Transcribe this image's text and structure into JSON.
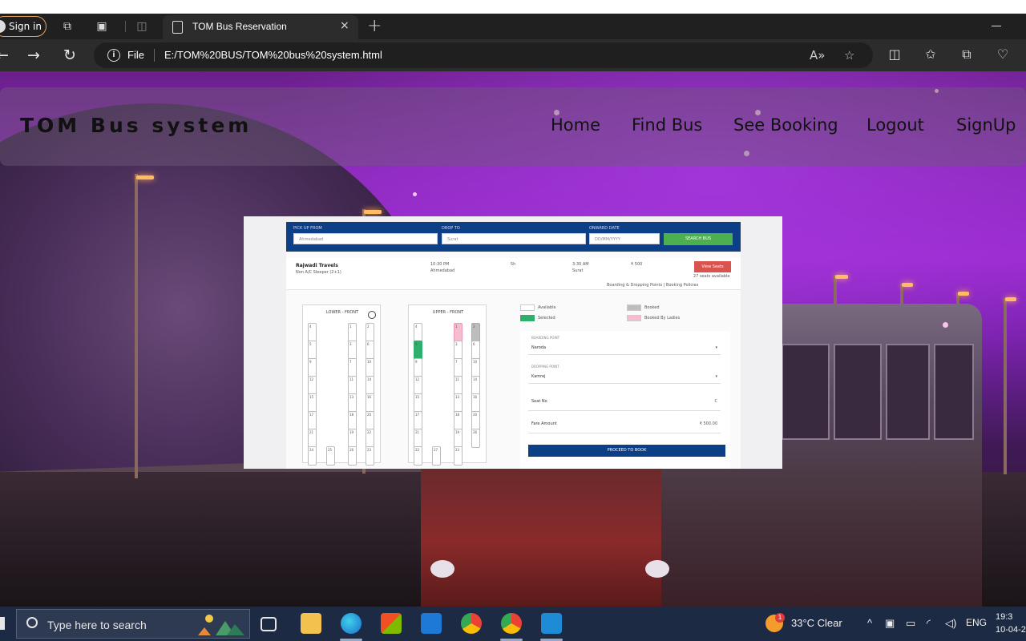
{
  "browser": {
    "sign_in_label": "Sign in",
    "tab_title": "TOM Bus Reservation",
    "new_tab_symbol": "+",
    "close_tab_symbol": "×",
    "file_label": "File",
    "url": "E:/TOM%20BUS/TOM%20bus%20system.html"
  },
  "site": {
    "brand": "TOM Bus system",
    "nav": [
      "Home",
      "Find Bus",
      "See Booking",
      "Logout",
      "SignUp"
    ]
  },
  "embedded_screenshot": {
    "search": {
      "pickup_label": "PICK UP FROM",
      "pickup_value": "Ahmedabad",
      "drop_label": "DROP TO",
      "drop_value": "Surat",
      "date_label": "ONWARD DATE",
      "date_value": "DD/MM/YYYY",
      "search_button": "SEARCH BUS"
    },
    "bus": {
      "name": "Rajwadi Travels",
      "type": "Non A/C Sleeper (2+1)",
      "depart_time": "10:30 PM",
      "depart_city": "Ahmedabad",
      "duration": "5h",
      "arrive_time": "3:30 AM",
      "arrive_city": "Surat",
      "price": "₹ 500",
      "view_button": "View Seats",
      "seats_available": "27 seats available",
      "links": "Boarding & Dropping Points  |  Booking Policies"
    },
    "lower_deck_title": "LOWER - FRONT",
    "upper_deck_title": "UPPER - FRONT",
    "lower_seats": [
      "4",
      "1",
      "2",
      "5",
      "3",
      "6",
      "9",
      "7",
      "10",
      "12",
      "11",
      "14",
      "15",
      "13",
      "16",
      "17",
      "18",
      "20",
      "21",
      "19",
      "22",
      "24",
      "25",
      "26",
      "23"
    ],
    "upper_seats": [
      "4",
      "1",
      "2",
      "5",
      "3",
      "6",
      "9",
      "7",
      "10",
      "12",
      "11",
      "14",
      "15",
      "13",
      "16",
      "17",
      "18",
      "20",
      "21",
      "19",
      "26",
      "22",
      "27",
      "23"
    ],
    "legend": {
      "available": "Available",
      "selected": "Selected",
      "booked": "Booked",
      "booked_ladies": "Booked By Ladies"
    },
    "form": {
      "boarding_label": "BOARDING POINT",
      "boarding_value": "Naroda",
      "dropping_label": "DROPPING POINT",
      "dropping_value": "Kamrej",
      "seat_label": "Seat No",
      "seat_value": "C",
      "fare_label": "Fare Amount",
      "fare_value": "₹ 500.00",
      "proceed_button": "PROCEED TO BOOK"
    }
  },
  "taskbar": {
    "search_placeholder": "Type here to search",
    "weather": "33°C  Clear",
    "weather_badge": "1",
    "language": "ENG",
    "time": "19:3",
    "date": "10-04-2"
  },
  "colors": {
    "tab_bar": "#202020",
    "address_bar": "#2c2c2c",
    "taskbar": "#1c2a44",
    "app_blue": "#0d3f86",
    "search_green": "#4caf50",
    "view_red": "#d9534f",
    "seat_selected": "#2eaf6e",
    "seat_ladies": "#f6bcd2"
  }
}
